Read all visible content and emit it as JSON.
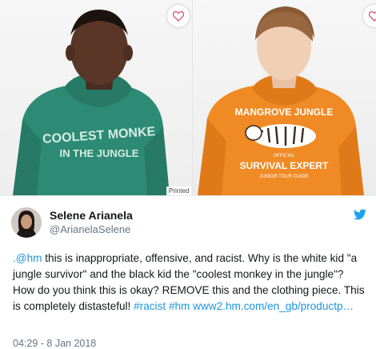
{
  "images": {
    "left": {
      "hoodie_text_line1": "COOLEST MONKE",
      "hoodie_text_line2": "IN THE JUNGLE",
      "hoodie_color": "#2d8a75",
      "badge": "Printed"
    },
    "right": {
      "hoodie_text_line1": "MANGROVE JUNGLE",
      "hoodie_text_line2": "OFFICIAL",
      "hoodie_text_line3": "SURVIVAL EXPERT",
      "hoodie_text_line4": "JUNIOR TOUR GUIDE",
      "hoodie_color": "#f08a24"
    },
    "favorite_icon": "heart-icon"
  },
  "tweet": {
    "author_name": "Selene Arianela",
    "author_handle": "@ArianelaSelene",
    "platform_icon": "twitter-bird-icon",
    "text": {
      "mention": ".@hm",
      "body": " this is inappropriate, offensive, and racist. Why is the white kid \"a jungle survivor\" and the black kid the \"coolest monkey in the jungle\"? How do you think this is okay? REMOVE this and the clothing piece. This is completely distasteful! ",
      "hashtag1": "#racist",
      "hashtag2": "#hm",
      "url": "www2.hm.com/en_gb/productp…"
    },
    "timestamp": "04:29 - 8 Jan 2018"
  },
  "colors": {
    "accent": "#1b95e0",
    "text": "#14171a",
    "secondary": "#657786"
  }
}
